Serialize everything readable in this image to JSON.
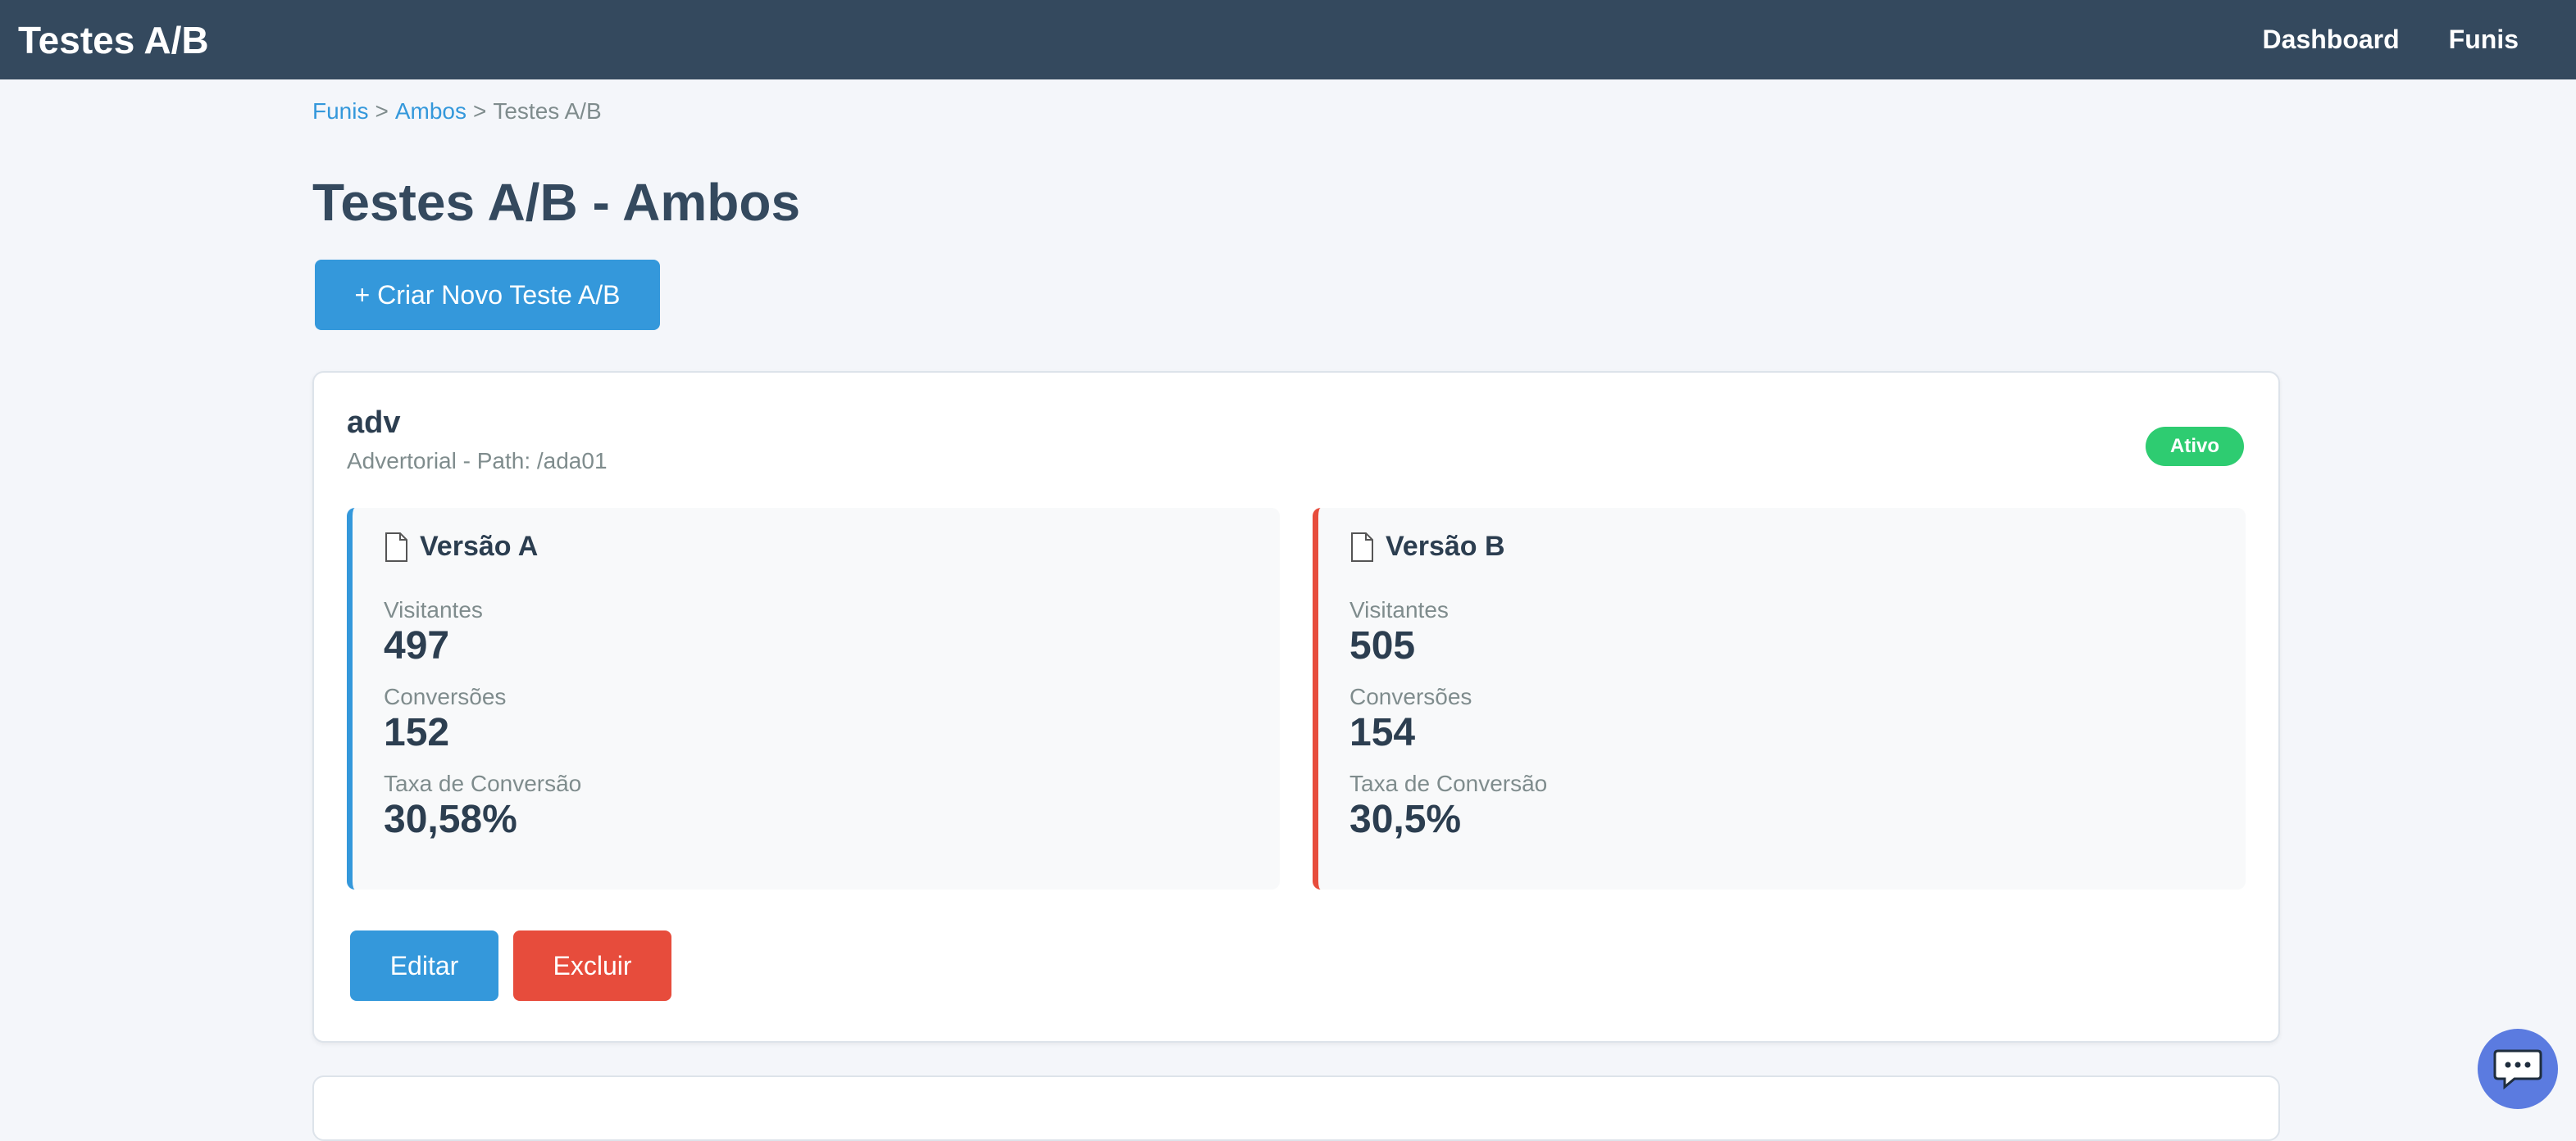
{
  "navbar": {
    "brand": "Testes A/B",
    "links": [
      "Dashboard",
      "Funis"
    ]
  },
  "breadcrumb": {
    "items": [
      "Funis",
      "Ambos",
      "Testes A/B"
    ],
    "separator": ">"
  },
  "page": {
    "title": "Testes A/B - Ambos",
    "create_button": "+ Criar Novo Teste A/B"
  },
  "test": {
    "name": "adv",
    "subtitle": "Advertorial - Path: /ada01",
    "status": "Ativo",
    "versions": [
      {
        "title": "Versão A",
        "accent": "#3498db",
        "icon": "document-icon",
        "visitors_label": "Visitantes",
        "visitors": "497",
        "conversions_label": "Conversões",
        "conversions": "152",
        "rate_label": "Taxa de Conversão",
        "rate": "30,58%"
      },
      {
        "title": "Versão B",
        "accent": "#e74c3c",
        "icon": "document-icon",
        "visitors_label": "Visitantes",
        "visitors": "505",
        "conversions_label": "Conversões",
        "conversions": "154",
        "rate_label": "Taxa de Conversão",
        "rate": "30,5%"
      }
    ],
    "edit_button": "Editar",
    "delete_button": "Excluir"
  },
  "colors": {
    "navbar": "#34495e",
    "primary": "#3498db",
    "danger": "#e74c3c",
    "success": "#2ecc71"
  },
  "chat": {
    "icon": "chat-icon"
  }
}
